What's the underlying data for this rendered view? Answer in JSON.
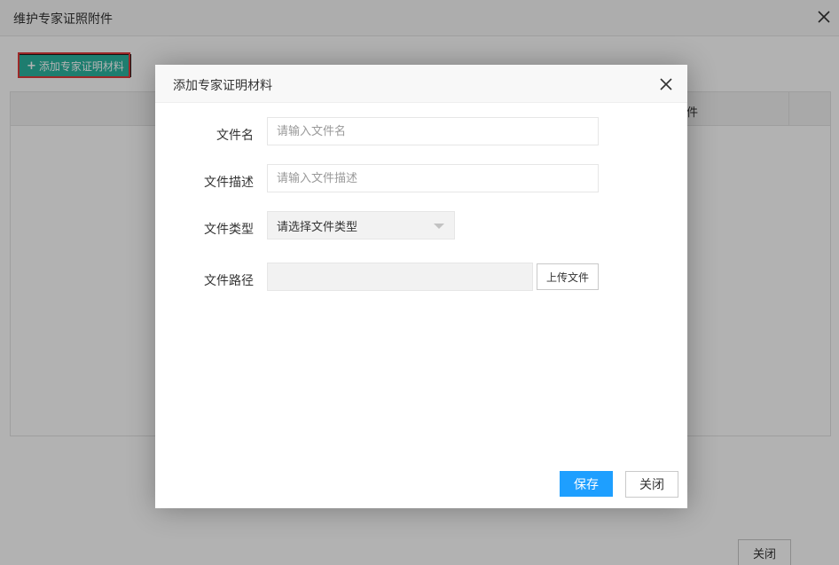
{
  "background": {
    "title": "维护专家证照附件",
    "add_button_label": "添加专家证明材料",
    "table_column_label": "件",
    "close_button_label": "关闭",
    "highlight_color": "#e03a3a",
    "accent_color": "#2bb3a0"
  },
  "modal": {
    "title": "添加专家证明材料",
    "fields": {
      "file_name": {
        "label": "文件名",
        "placeholder": "请输入文件名",
        "value": ""
      },
      "file_desc": {
        "label": "文件描述",
        "placeholder": "请输入文件描述",
        "value": ""
      },
      "file_type": {
        "label": "文件类型",
        "selected": "请选择文件类型"
      },
      "file_path": {
        "label": "文件路径",
        "value": "",
        "upload_label": "上传文件"
      }
    },
    "save_label": "保存",
    "close_label": "关闭",
    "save_color": "#1e9fff"
  },
  "icons": {
    "bg_close": "close-icon",
    "modal_close": "close-icon",
    "add": "plus-icon",
    "select_arrow": "chevron-down-icon"
  }
}
